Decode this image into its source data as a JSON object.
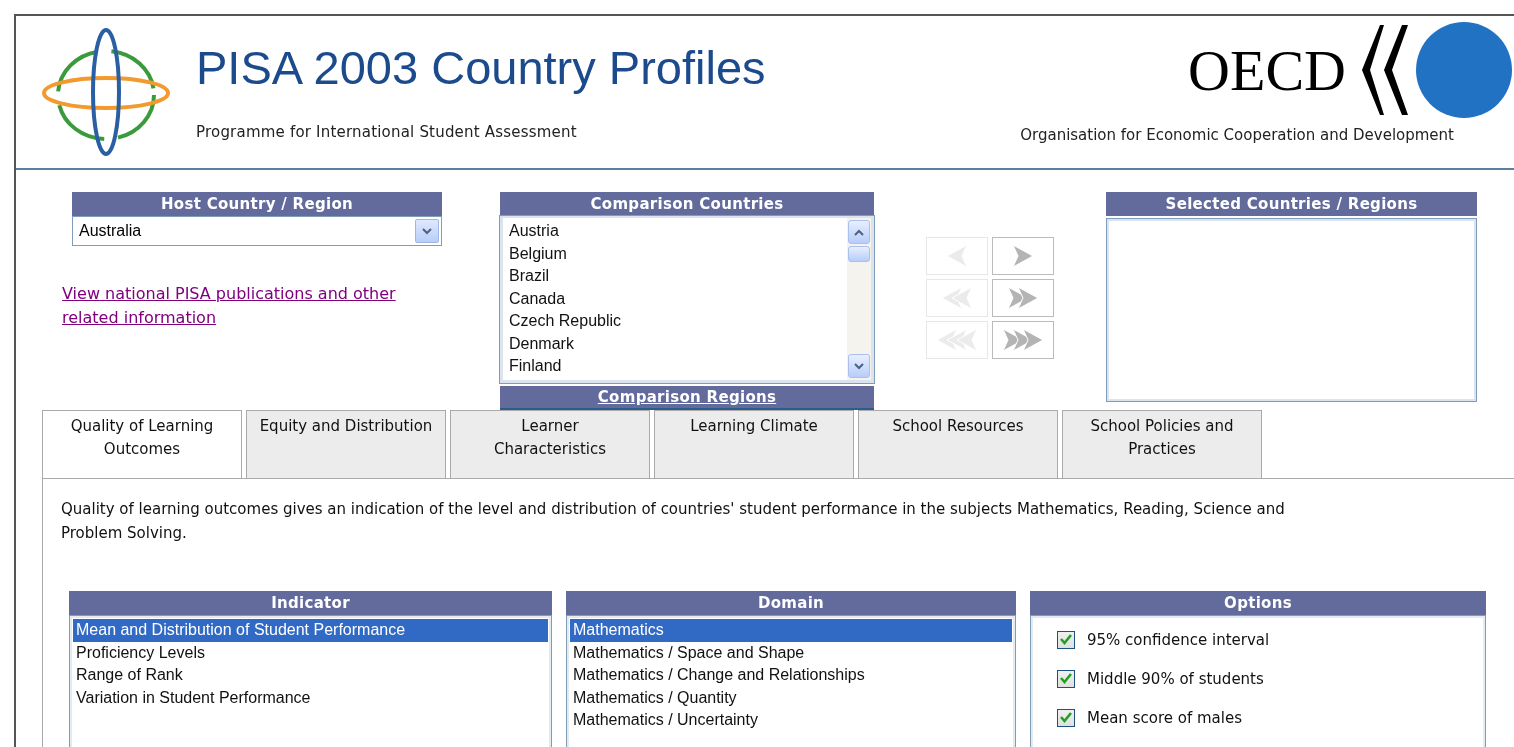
{
  "header": {
    "title": "PISA 2003 Country Profiles",
    "subtitle": "Programme for International Student Assessment",
    "org_logo": "OECD",
    "org_name": "Organisation for Economic Cooperation and Development"
  },
  "host": {
    "heading": "Host Country / Region",
    "value": "Australia"
  },
  "link": "View national PISA publications and other related information",
  "comparison": {
    "heading": "Comparison Countries",
    "items": [
      "Austria",
      "Belgium",
      "Brazil",
      "Canada",
      "Czech Republic",
      "Denmark",
      "Finland"
    ],
    "footer_link": "Comparison Regions"
  },
  "move_buttons": [
    {
      "kind": "left",
      "disabled": true
    },
    {
      "kind": "right",
      "disabled": false
    },
    {
      "kind": "leftmore",
      "disabled": true
    },
    {
      "kind": "rightmore",
      "disabled": false
    },
    {
      "kind": "leftall",
      "disabled": true
    },
    {
      "kind": "rightall",
      "disabled": false
    }
  ],
  "selected_countries": {
    "heading": "Selected Countries / Regions"
  },
  "tabs": [
    {
      "label": "Quality of Learning Outcomes",
      "selected": true
    },
    {
      "label": "Equity and Distribution",
      "selected": false
    },
    {
      "label": "Learner Characteristics",
      "selected": false
    },
    {
      "label": "Learning Climate",
      "selected": false
    },
    {
      "label": "School Resources",
      "selected": false
    },
    {
      "label": "School Policies and Practices",
      "selected": false
    }
  ],
  "description": "Quality of learning outcomes gives an indication of the level and distribution of countries' student performance in the subjects Mathematics, Reading, Science and Problem Solving.",
  "indicator": {
    "heading": "Indicator",
    "items": [
      {
        "label": "Mean and Distribution of Student Performance",
        "selected": true
      },
      {
        "label": "Proficiency Levels",
        "selected": false
      },
      {
        "label": "Range of Rank",
        "selected": false
      },
      {
        "label": "Variation in Student Performance",
        "selected": false
      }
    ]
  },
  "domain": {
    "heading": "Domain",
    "items": [
      {
        "label": "Mathematics",
        "selected": true
      },
      {
        "label": "Mathematics / Space and Shape",
        "selected": false
      },
      {
        "label": "Mathematics / Change and Relationships",
        "selected": false
      },
      {
        "label": "Mathematics / Quantity",
        "selected": false
      },
      {
        "label": "Mathematics / Uncertainty",
        "selected": false
      }
    ]
  },
  "options": {
    "heading": "Options",
    "items": [
      {
        "label": "95% confidence interval",
        "checked": true
      },
      {
        "label": "Middle 90% of students",
        "checked": true
      },
      {
        "label": "Mean score of males",
        "checked": true
      }
    ]
  }
}
